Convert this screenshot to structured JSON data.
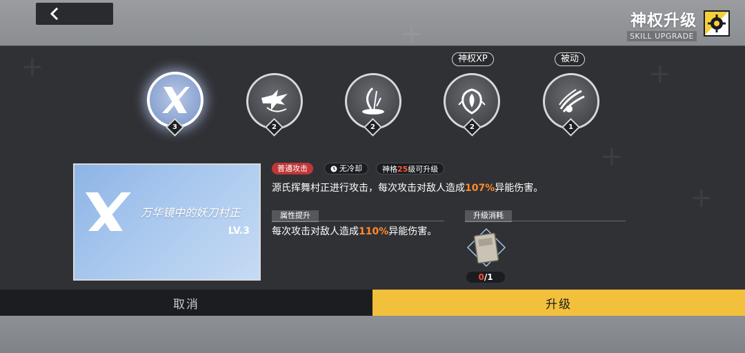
{
  "header": {
    "title": "神权升级",
    "subtitle": "SKILL UPGRADE",
    "back_icon": "chevron-left-icon",
    "emblem_icon": "gear-emblem-icon"
  },
  "skills": [
    {
      "level": "3",
      "icon": "x-slash-icon",
      "active": true,
      "tag": ""
    },
    {
      "level": "2",
      "icon": "dragon-strike-icon",
      "active": false,
      "tag": ""
    },
    {
      "level": "2",
      "icon": "blade-swirl-icon",
      "active": false,
      "tag": ""
    },
    {
      "level": "2",
      "icon": "crest-burst-icon",
      "active": false,
      "tag": "神权XP"
    },
    {
      "level": "1",
      "icon": "claw-burst-icon",
      "active": false,
      "tag": "被动"
    }
  ],
  "card": {
    "name": "万华镜中的妖刀村正",
    "level": "LV.3"
  },
  "info": {
    "type_label": "普通攻击",
    "cooldown_label": "无冷却",
    "req_prefix": "神格",
    "req_level": "25",
    "req_suffix": "级可升级",
    "desc_prefix": "源氏挥舞村正进行攻击，每次攻击对敌人造成",
    "desc_value": "107%",
    "desc_suffix": "异能伤害。"
  },
  "upgrade": {
    "section_title": "属性提升",
    "desc_prefix": "每次攻击对敌人造成",
    "desc_value": "110%",
    "desc_suffix": "异能伤害。"
  },
  "cost": {
    "section_title": "升级消耗",
    "item_icon": "skill-book-icon",
    "have": "0",
    "need": "/1"
  },
  "actions": {
    "cancel_label": "取消",
    "upgrade_label": "升级"
  },
  "colors": {
    "accent_yellow": "#f3c03c",
    "highlight_orange": "#ff8a2a",
    "danger_red": "#c0373a",
    "panel_bg": "#303135"
  }
}
